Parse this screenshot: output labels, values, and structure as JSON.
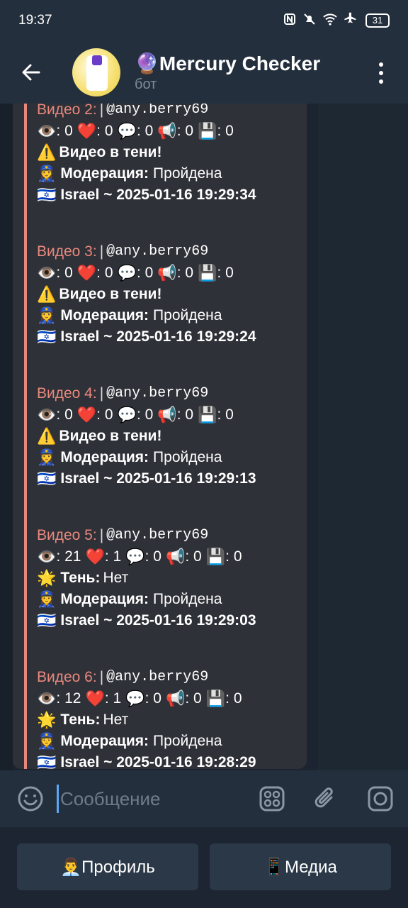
{
  "status_bar": {
    "time": "19:37",
    "battery": "31"
  },
  "header": {
    "title_emoji": "🔮",
    "title": "Mercury Checker",
    "subtitle": "бот"
  },
  "entries": [
    {
      "label": "Видео 2:",
      "sep": "|",
      "user": "@any.berry69",
      "views": "0",
      "likes": "0",
      "comments": "0",
      "shares": "0",
      "saves": "0",
      "warn_icon": "⚠️",
      "warn_text": "Видео в тени!",
      "mod_label": "Модерация:",
      "mod_value": "Пройдена",
      "geo": "Israel ~ 2025-01-16 19:29:34"
    },
    {
      "label": "Видео 3:",
      "sep": "|",
      "user": "@any.berry69",
      "views": "0",
      "likes": "0",
      "comments": "0",
      "shares": "0",
      "saves": "0",
      "warn_icon": "⚠️",
      "warn_text": "Видео в тени!",
      "mod_label": "Модерация:",
      "mod_value": "Пройдена",
      "geo": "Israel ~ 2025-01-16 19:29:24"
    },
    {
      "label": "Видео 4:",
      "sep": "|",
      "user": "@any.berry69",
      "views": "0",
      "likes": "0",
      "comments": "0",
      "shares": "0",
      "saves": "0",
      "warn_icon": "⚠️",
      "warn_text": "Видео в тени!",
      "mod_label": "Модерация:",
      "mod_value": "Пройдена",
      "geo": "Israel ~ 2025-01-16 19:29:13"
    },
    {
      "label": "Видео 5:",
      "sep": "|",
      "user": "@any.berry69",
      "views": "21",
      "likes": "1",
      "comments": "0",
      "shares": "0",
      "saves": "0",
      "shadow_label": "Тень:",
      "shadow_value": "Нет",
      "mod_label": "Модерация:",
      "mod_value": "Пройдена",
      "geo": "Israel ~ 2025-01-16 19:29:03"
    },
    {
      "label": "Видео 6:",
      "sep": "|",
      "user": "@any.berry69",
      "views": "12",
      "likes": "1",
      "comments": "0",
      "shares": "0",
      "saves": "0",
      "shadow_label": "Тень:",
      "shadow_value": "Нет",
      "mod_label": "Модерация:",
      "mod_value": "Пройдена",
      "geo": "Israel ~ 2025-01-16 19:28:29"
    }
  ],
  "composer": {
    "placeholder": "Сообщение"
  },
  "keyboard": {
    "profile_label": "👨‍💼Профиль",
    "media_label": "📱Медиа"
  },
  "colors": {
    "accent_quote": "#e8887d",
    "bg": "#1f2936",
    "header": "#242f3d"
  }
}
